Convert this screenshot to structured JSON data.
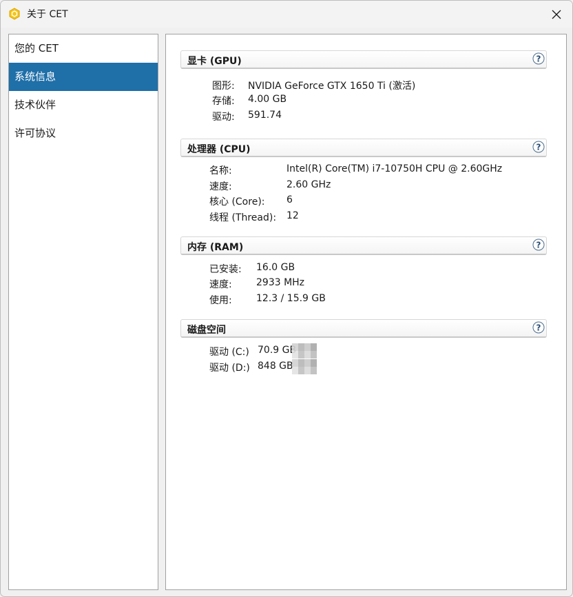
{
  "window": {
    "title": "关于 CET",
    "accent_color": "#1f6fa8",
    "icon": "cet-hexagon-icon"
  },
  "sidebar": {
    "items": [
      {
        "label": "您的 CET",
        "selected": false
      },
      {
        "label": "系统信息",
        "selected": true
      },
      {
        "label": "技术伙伴",
        "selected": false
      },
      {
        "label": "许可协议",
        "selected": false
      }
    ]
  },
  "sections": {
    "gpu": {
      "title": "显卡 (GPU)",
      "rows": [
        {
          "label": "图形:",
          "value": "NVIDIA GeForce GTX 1650 Ti (激活)"
        },
        {
          "label": "存储:",
          "value": "4.00 GB"
        },
        {
          "label": "驱动:",
          "value": "591.74"
        }
      ]
    },
    "cpu": {
      "title": "处理器 (CPU)",
      "rows": [
        {
          "label": "名称:",
          "value": "Intel(R) Core(TM) i7-10750H CPU @ 2.60GHz"
        },
        {
          "label": "速度:",
          "value": "2.60 GHz"
        },
        {
          "label": "核心 (Core):",
          "value": "6"
        },
        {
          "label": "线程 (Thread):",
          "value": "12"
        }
      ]
    },
    "ram": {
      "title": "内存 (RAM)",
      "rows": [
        {
          "label": "已安装:",
          "value": "16.0 GB"
        },
        {
          "label": "速度:",
          "value": "2933 MHz"
        },
        {
          "label": "使用:",
          "value": "12.3 / 15.9 GB"
        }
      ]
    },
    "disk": {
      "title": "磁盘空间",
      "rows": [
        {
          "label": "驱动 (C:)",
          "value": "70.9 GB"
        },
        {
          "label": "驱动 (D:)",
          "value": "848 GB"
        }
      ]
    }
  }
}
